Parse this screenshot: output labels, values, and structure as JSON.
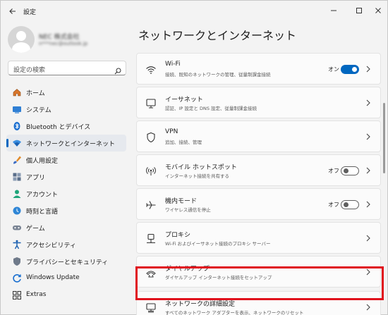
{
  "window": {
    "title": "設定",
    "back_icon": "back-arrow-icon"
  },
  "profile": {
    "name": "NEC 株式会社",
    "email": "n***nec@outlook.jp"
  },
  "search": {
    "placeholder": "設定の検索"
  },
  "sidebar": {
    "items": [
      {
        "label": "ホーム",
        "icon": "home-icon",
        "active": false
      },
      {
        "label": "システム",
        "icon": "system-icon",
        "active": false
      },
      {
        "label": "Bluetooth とデバイス",
        "icon": "bluetooth-icon",
        "active": false
      },
      {
        "label": "ネットワークとインターネット",
        "icon": "network-icon",
        "active": true
      },
      {
        "label": "個人用設定",
        "icon": "personalization-icon",
        "active": false
      },
      {
        "label": "アプリ",
        "icon": "apps-icon",
        "active": false
      },
      {
        "label": "アカウント",
        "icon": "accounts-icon",
        "active": false
      },
      {
        "label": "時刻と言語",
        "icon": "time-language-icon",
        "active": false
      },
      {
        "label": "ゲーム",
        "icon": "gaming-icon",
        "active": false
      },
      {
        "label": "アクセシビリティ",
        "icon": "accessibility-icon",
        "active": false
      },
      {
        "label": "プライバシーとセキュリティ",
        "icon": "privacy-icon",
        "active": false
      },
      {
        "label": "Windows Update",
        "icon": "windows-update-icon",
        "active": false
      },
      {
        "label": "Extras",
        "icon": "extras-icon",
        "active": false
      }
    ]
  },
  "main": {
    "title": "ネットワークとインターネット",
    "cards": [
      {
        "title": "Wi-Fi",
        "subtitle": "接続、既知のネットワークの管理、従量制課金接続",
        "icon": "wifi-icon",
        "toggle": "オン",
        "toggle_state": "on"
      },
      {
        "title": "イーサネット",
        "subtitle": "認証、IP 設定と DNS 設定、従量制課金接続",
        "icon": "ethernet-icon"
      },
      {
        "title": "VPN",
        "subtitle": "追加、接続、管理",
        "icon": "vpn-shield-icon"
      },
      {
        "title": "モバイル ホットスポット",
        "subtitle": "インターネット接続を共有する",
        "icon": "hotspot-icon",
        "toggle": "オフ",
        "toggle_state": "off"
      },
      {
        "title": "機内モード",
        "subtitle": "ワイヤレス通信を停止",
        "icon": "airplane-icon",
        "toggle": "オフ",
        "toggle_state": "off"
      },
      {
        "title": "プロキシ",
        "subtitle": "Wi-Fi およびイーサネット接続のプロキシ サーバー",
        "icon": "proxy-icon"
      },
      {
        "title": "ダイヤルアップ",
        "subtitle": "ダイヤルアップ インターネット接続をセットアップ",
        "icon": "dialup-icon"
      },
      {
        "title": "ネットワークの詳細設定",
        "subtitle": "すべてのネットワーク アダプターを表示、ネットワークのリセット",
        "icon": "advanced-network-icon"
      }
    ]
  },
  "colors": {
    "accent": "#0067c0",
    "highlight": "#e0101c"
  }
}
